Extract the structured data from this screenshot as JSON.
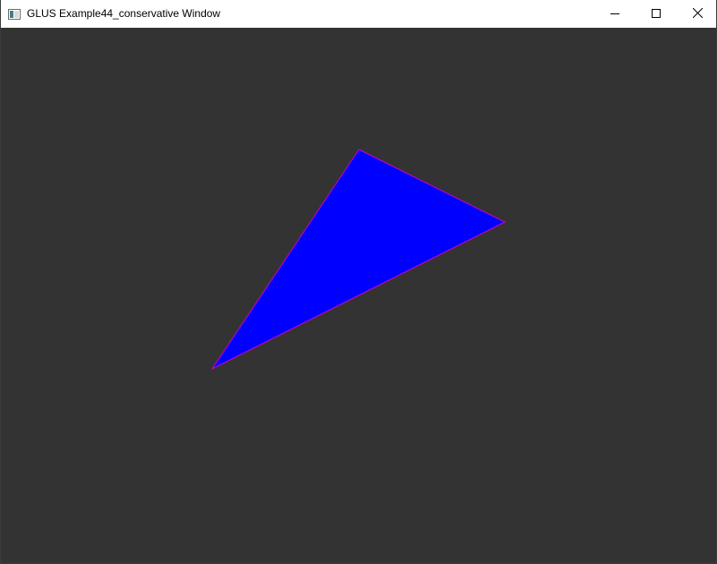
{
  "window": {
    "title": "GLUS Example44_conservative Window",
    "icon": "app-window-icon",
    "controls": {
      "minimize": "minimize-icon",
      "maximize": "maximize-icon",
      "close": "close-icon"
    }
  },
  "scene": {
    "background_color": "#333333",
    "triangle_fill": "#0000ff",
    "triangle_edge": "#cc00cc"
  }
}
